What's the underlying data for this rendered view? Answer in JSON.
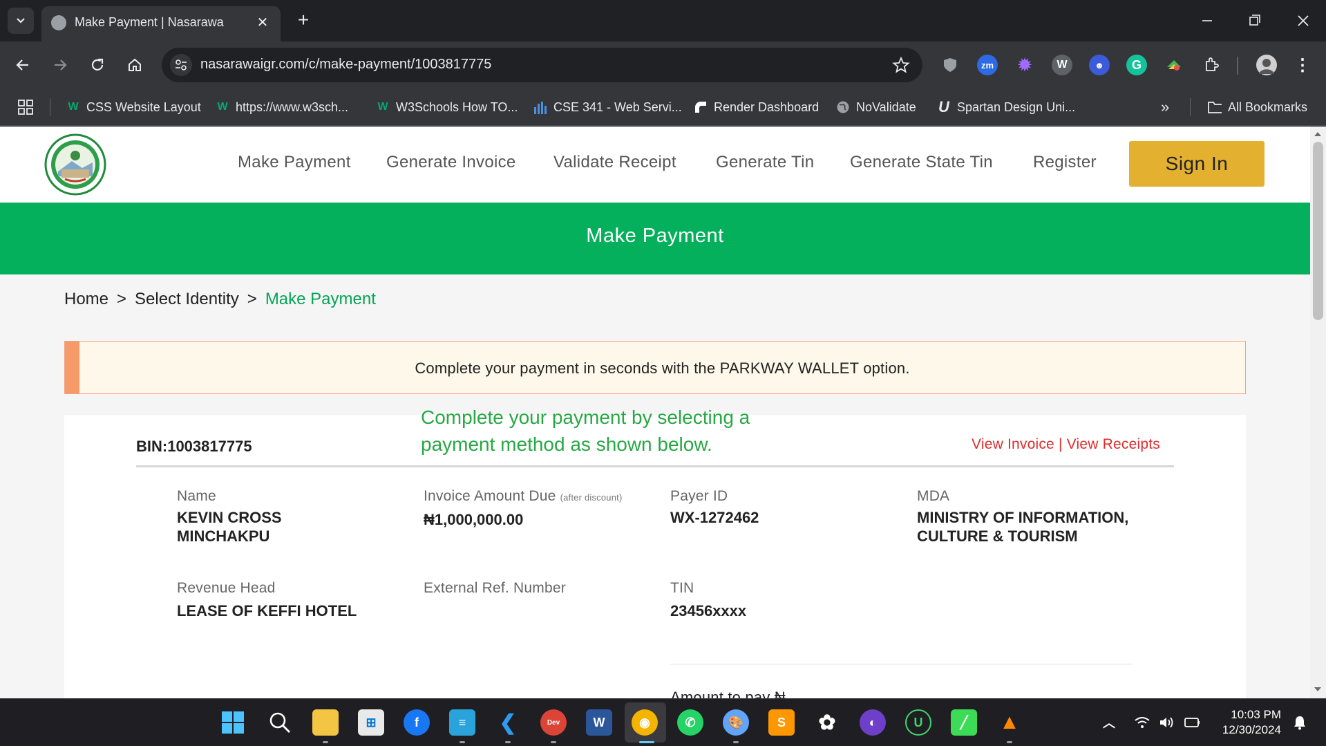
{
  "browser": {
    "tab_title": "Make Payment | Nasarawa",
    "url": "nasarawaigr.com/c/make-payment/1003817775",
    "bookmarks": [
      {
        "label": "CSS Website Layout",
        "icon": "w3schools-icon"
      },
      {
        "label": "https://www.w3sch...",
        "icon": "w3schools-icon"
      },
      {
        "label": "W3Schools How TO...",
        "icon": "w3schools-icon"
      },
      {
        "label": "CSE 341 - Web Servi...",
        "icon": "chart-icon"
      },
      {
        "label": "Render Dashboard",
        "icon": "render-icon"
      },
      {
        "label": "NoValidate",
        "icon": "globe-icon"
      },
      {
        "label": "Spartan Design Uni...",
        "icon": "u-icon"
      }
    ],
    "all_bookmarks": "All Bookmarks",
    "overflow": "»"
  },
  "site": {
    "nav": [
      "Make Payment",
      "Generate Invoice",
      "Validate Receipt",
      "Generate Tin",
      "Generate State Tin",
      "Register"
    ],
    "sign_in": "Sign In",
    "banner_title": "Make Payment",
    "breadcrumb": {
      "home": "Home",
      "sep": ">",
      "select_identity": "Select Identity",
      "current": "Make Payment"
    },
    "alert": "Complete your payment in seconds with the PARKWAY WALLET option.",
    "note": "Complete your payment by selecting a payment method as shown below.",
    "bin": "BIN:1003817775",
    "links": {
      "view_invoice": "View Invoice",
      "sep": " | ",
      "view_receipts": "View Receipts"
    },
    "fields": {
      "name_label": "Name",
      "name_value": "KEVIN CROSS MINCHAKPU",
      "invoice_label": "Invoice Amount Due",
      "invoice_note": "(after discount)",
      "invoice_value": "₦1,000,000.00",
      "payer_label": "Payer ID",
      "payer_value": "WX-1272462",
      "mda_label": "MDA",
      "mda_value": "MINISTRY OF INFORMATION, CULTURE & TOURISM",
      "revenue_label": "Revenue Head",
      "revenue_value": "LEASE OF KEFFI HOTEL",
      "extref_label": "External Ref. Number",
      "tin_label": "TIN",
      "tin_value": "23456xxxx",
      "amount_label": "Amount to pay ₦"
    },
    "colors": {
      "brand_green": "#04b05b",
      "sign_in": "#e3b02f",
      "link_red": "#e02c2c"
    }
  },
  "taskbar": {
    "time": "10:03 PM",
    "date": "12/30/2024"
  }
}
